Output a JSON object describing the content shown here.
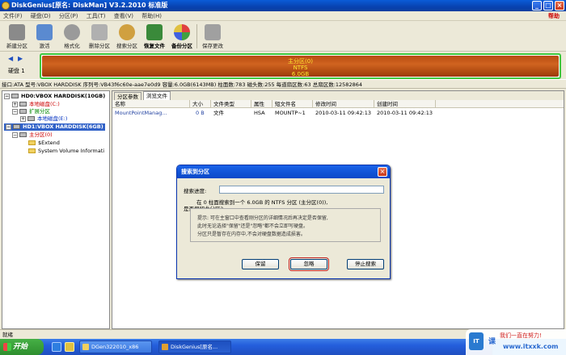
{
  "title": "DiskGenius[原名: DiskMan] V3.2.2010 标准版",
  "window_buttons": [
    "_",
    "□",
    "×"
  ],
  "menu": [
    "文件(F)",
    "硬盘(D)",
    "分区(P)",
    "工具(T)",
    "查看(V)",
    "帮助(H)"
  ],
  "help_label": "帮助",
  "toolbar": [
    {
      "label": "新建分区",
      "icon": "new-partition-icon",
      "color": "#8a8a8a"
    },
    {
      "label": "激活",
      "icon": "activate-icon",
      "color": "#5a8ad0"
    },
    {
      "label": "格式化",
      "icon": "format-icon",
      "color": "#9a9a9a"
    },
    {
      "label": "删除分区",
      "icon": "delete-icon",
      "color": "#b0b0b0"
    },
    {
      "label": "搜索分区",
      "icon": "search-partition-icon",
      "color": "#d0a040"
    },
    {
      "label": "恢复文件",
      "icon": "recover-files-icon",
      "color": "#3a8a3a"
    },
    {
      "label": "备份分区",
      "icon": "backup-partition-icon",
      "color": "#c84a9a"
    },
    {
      "label": "保存更改",
      "icon": "save-changes-icon",
      "color": "#a0a0a0"
    }
  ],
  "disk_label": "硬盘 1",
  "partition": {
    "name": "主分区(0)",
    "fs": "NTFS",
    "size": "6.0GB",
    "border_color": "#3ec83e"
  },
  "info_bar": "接口:ATA  型号:VBOX HARDDISK  序列号:VB43f6c60e-aae7e0d9  容量:6.0GB(6143MB)  柱面数:783  磁头数:255  每道扇区数:63  总扇区数:12582864",
  "tree": {
    "hd0": "HD0:VBOX HARDDISK(10GB)",
    "hd0_local_c": "本地磁盘(C:)",
    "hd0_extended": "扩展分区",
    "hd0_local_e": "本地磁盘(E:)",
    "hd1": "HD1:VBOX HARDDISK(6GB)",
    "hd1_primary": "主分区(0)",
    "extend": "$Extend",
    "svi": "System Volume Informati"
  },
  "tabs": [
    "分区参数",
    "浏览文件"
  ],
  "columns": [
    "名称",
    "大小",
    "文件类型",
    "属性",
    "短文件名",
    "修改时间",
    "创建时间"
  ],
  "row": {
    "name": "MountPointManag...",
    "size": "0 B",
    "type": "文件",
    "attr": "HSA",
    "short": "MOUNTP~1",
    "modified": "2010-03-11 09:42:13",
    "created": "2010-03-11 09:42:13"
  },
  "dialog": {
    "title": "搜索到分区",
    "progress_label": "搜索进度:",
    "msg1": "在 0 柱面搜索到一个 6.0GB 的 NTFS 分区 (主分区(0)),",
    "msg2": "是否保留此分区?",
    "hint1": "提示: 可在主窗口中查看刚分区的详细情况后再决定是否保留,",
    "hint2": "此时无论选择\"保留\"还是\"忽略\"都不会立即写硬盘。",
    "hint3": "分区只是暂存在内存中,不会对硬盘数据造成损害。",
    "btn_keep": "保留",
    "btn_ignore": "忽略",
    "btn_stop": "停止搜索"
  },
  "status": "就绪",
  "taskbar": {
    "start": "开始",
    "tasks": [
      "DGen322010_x86",
      "DiskGenius[原名..."
    ]
  },
  "watermark": {
    "logo": "IT",
    "k": "课",
    "line1": "我们一直在努力!",
    "line2": "www.itxxk.com"
  }
}
